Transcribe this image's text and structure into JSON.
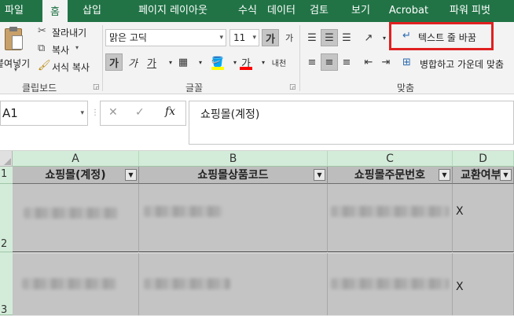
{
  "ribbon_tabs": [
    "파일",
    "홈",
    "삽입",
    "페이지 레이아웃",
    "수식",
    "데이터",
    "검토",
    "보기",
    "Acrobat",
    "파워 피벗"
  ],
  "clipboard": {
    "paste_label": "붙여넣기",
    "cut_label": "잘라내기",
    "copy_label": "복사",
    "format_painter_label": "서식 복사",
    "group_label": "클립보드"
  },
  "font": {
    "font_name": "맑은 고딕",
    "font_size": "11",
    "grow_label": "가",
    "shrink_label": "가",
    "bold_label": "가",
    "italic_label": "가",
    "underline_label": "가",
    "font_color_label": "가",
    "phonetic_label": "내천",
    "group_label": "글꼴"
  },
  "alignment": {
    "wrap_text_label": "텍스트 줄 바꿈",
    "merge_center_label": "병합하고 가운데 맞춤",
    "group_label": "맞춤"
  },
  "formula_bar": {
    "name_box": "A1",
    "cancel_icon": "✕",
    "enter_icon": "✓",
    "fx_label": "fx",
    "content": "쇼핑몰(계정)"
  },
  "columns": [
    "A",
    "B",
    "C",
    "D"
  ],
  "rows": [
    "1",
    "2",
    "3"
  ],
  "table": {
    "headers": [
      "쇼핑몰(계정)",
      "쇼핑몰상품코드",
      "쇼핑몰주문번호",
      "교환여부"
    ],
    "filter_icon": "▼",
    "row2_d": "X",
    "row3_d": "X"
  },
  "colors": {
    "accent": "#217346",
    "highlight_box": "#e02020"
  }
}
